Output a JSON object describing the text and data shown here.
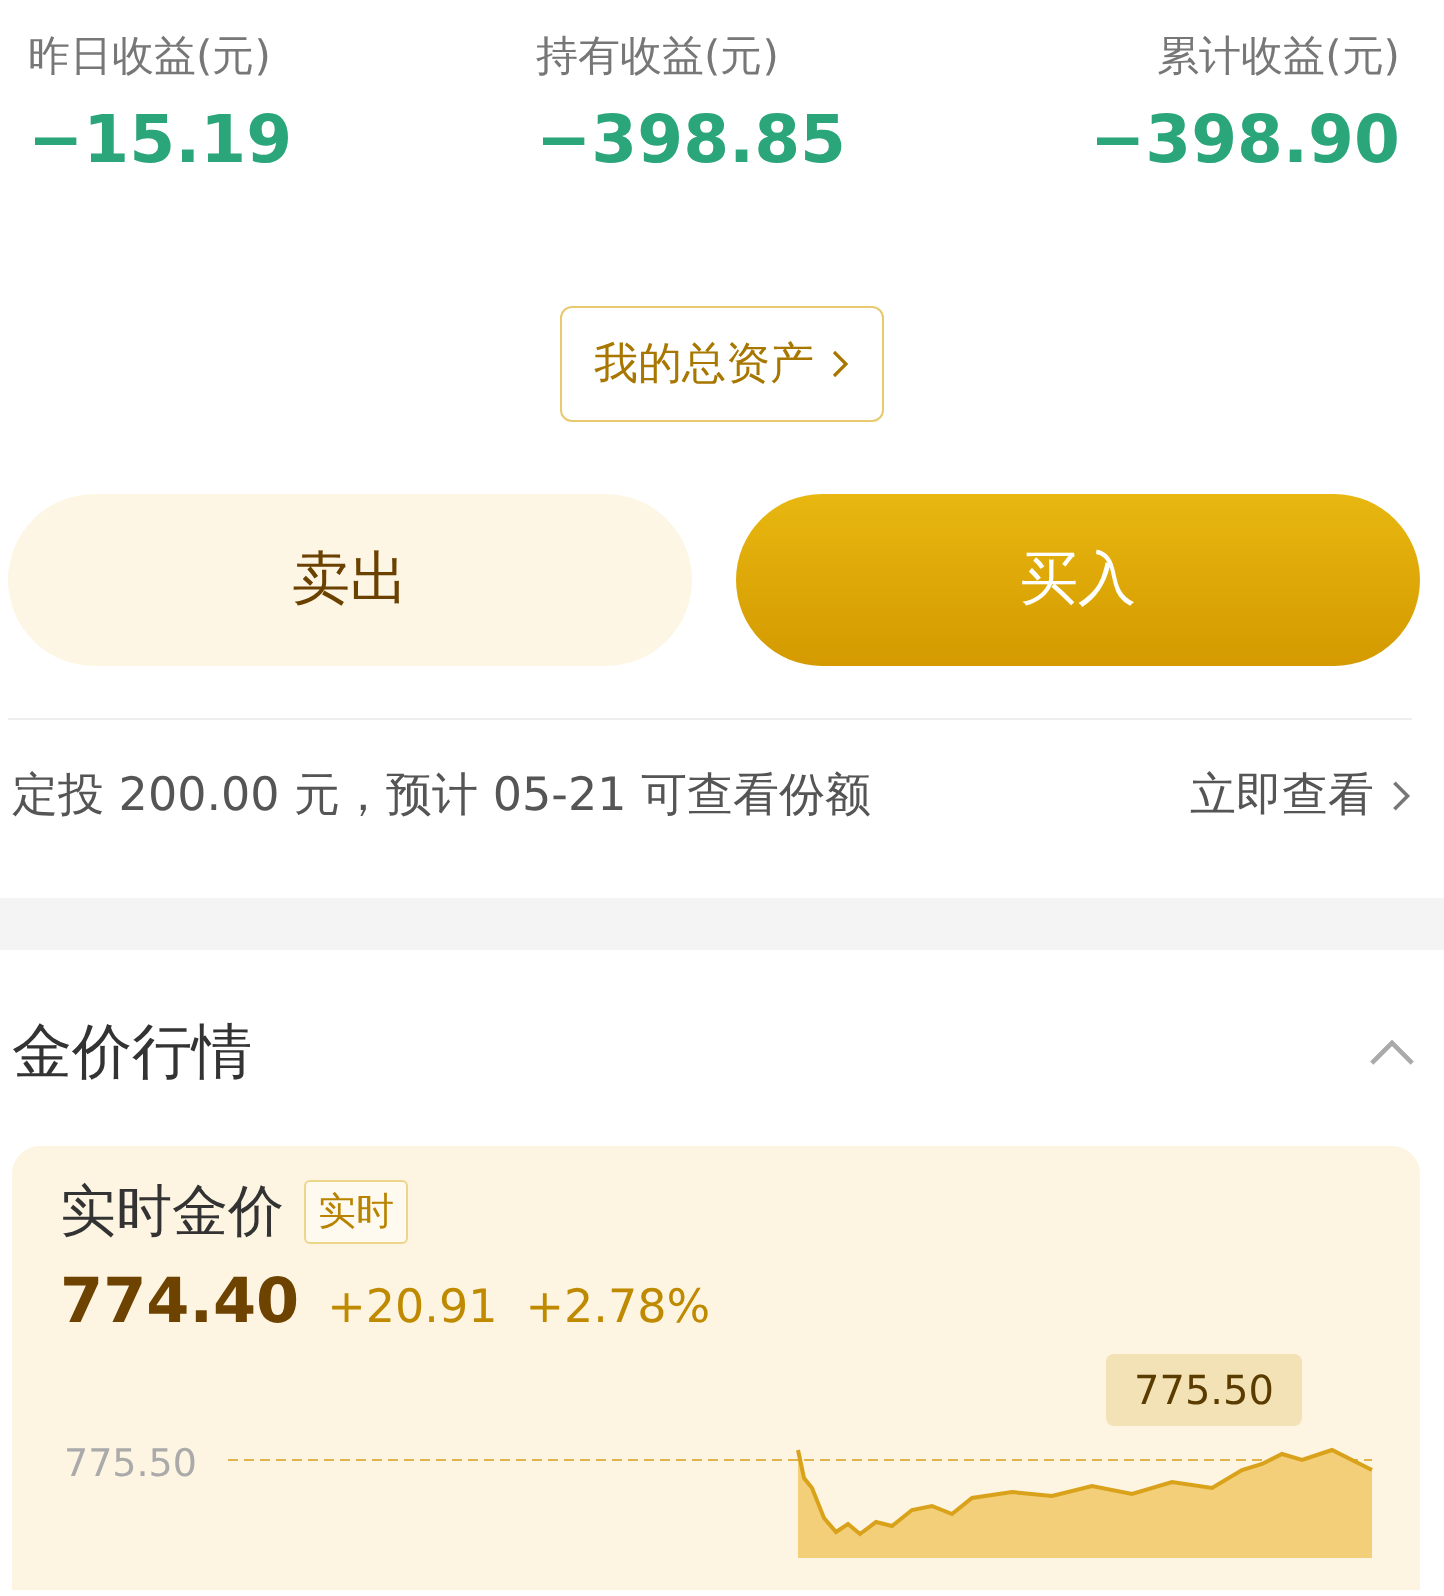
{
  "stats": [
    {
      "label": "昨日收益(元)",
      "value": "−15.19"
    },
    {
      "label": "持有收益(元)",
      "value": "−398.85"
    },
    {
      "label": "累计收益(元)",
      "value": "−398.90"
    }
  ],
  "assets_button": {
    "label": "我的总资产"
  },
  "actions": [
    {
      "label": "卖出",
      "kind": "sell"
    },
    {
      "label": "买入",
      "kind": "buy"
    }
  ],
  "auto_invest": {
    "text": "定投 200.00 元，预计 05-21 可查看份额",
    "link": "立即查看"
  },
  "section": {
    "title": "金价行情",
    "expanded": true
  },
  "card": {
    "title": "实时金价",
    "badge": "实时",
    "price": "774.40",
    "change": "+20.91",
    "change_pct": "+2.78%",
    "axis_label": "775.50",
    "tooltip": "775.50"
  }
}
